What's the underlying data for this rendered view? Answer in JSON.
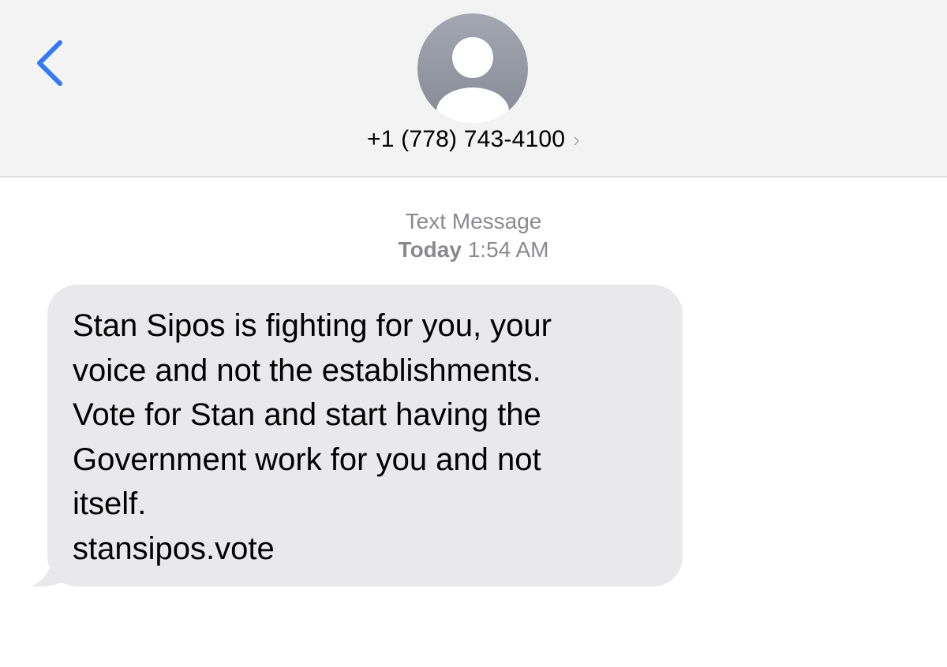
{
  "header": {
    "back_icon": "chevron-left-icon",
    "avatar_icon": "person-silhouette-icon",
    "contact": "+1 (778) 743-4100",
    "contact_chevron": "›"
  },
  "thread": {
    "service_label": "Text Message",
    "day": "Today",
    "time": "1:54 AM"
  },
  "message": {
    "lines": [
      "Stan Sipos is fighting for you, your",
      "voice and not the establishments.",
      "Vote for Stan and start having the",
      "Government work for you and not",
      "itself.",
      "stansipos.vote"
    ]
  },
  "colors": {
    "accent": "#3478f6",
    "header_bg": "#f3f3f3",
    "bubble_bg": "#e9e9eb",
    "meta_text": "#8a8a8e"
  }
}
